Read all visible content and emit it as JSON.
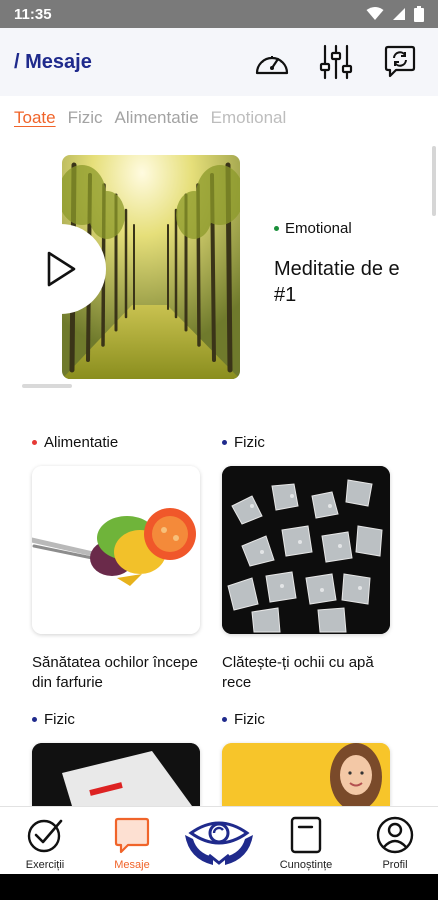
{
  "status_bar": {
    "time": "11:35"
  },
  "header": {
    "title": "/ Mesaje",
    "actions": [
      "speedometer-icon",
      "sliders-icon",
      "refresh-chat-icon"
    ]
  },
  "tabs": [
    {
      "label": "Toate",
      "active": true
    },
    {
      "label": "Fizic",
      "active": false
    },
    {
      "label": "Alimentatie",
      "active": false
    },
    {
      "label": "Emotional",
      "active": false
    }
  ],
  "featured": {
    "category": "Emotional",
    "category_color": "#1a8f3a",
    "title": "Meditatie de e\n#1"
  },
  "cards": [
    {
      "category": "Alimentatie",
      "color": "#e53935",
      "title": "Sănătatea ochilor începe din farfurie"
    },
    {
      "category": "Fizic",
      "color": "#1f2a8c",
      "title": "Clătește-ți ochii cu apă rece"
    },
    {
      "category": "Fizic",
      "color": "#1f2a8c",
      "title": ""
    },
    {
      "category": "Fizic",
      "color": "#1f2a8c",
      "title": ""
    }
  ],
  "nav": {
    "items": [
      {
        "label": "Exerciții"
      },
      {
        "label": "Mesaje",
        "active": true
      },
      {
        "label": ""
      },
      {
        "label": "Cunoștințe"
      },
      {
        "label": "Profil"
      }
    ]
  },
  "colors": {
    "accent": "#f0642a",
    "brand": "#1f2a8c"
  }
}
